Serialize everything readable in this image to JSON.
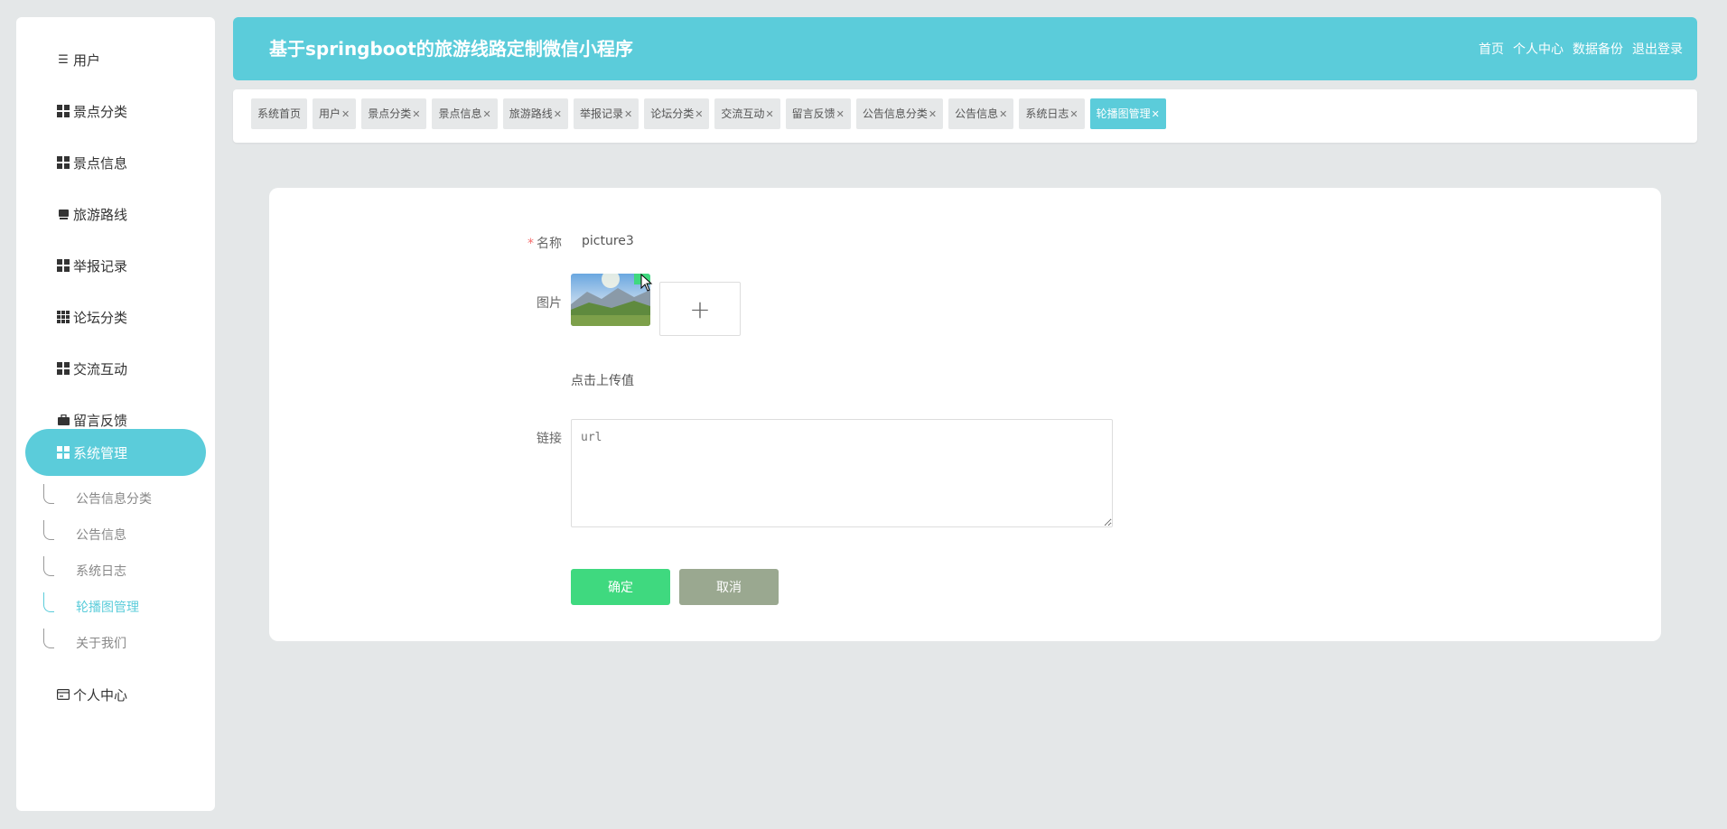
{
  "sidebar": {
    "items": [
      {
        "label": "用户",
        "icon": "list-icon"
      },
      {
        "label": "景点分类",
        "icon": "grid-icon"
      },
      {
        "label": "景点信息",
        "icon": "grid-icon"
      },
      {
        "label": "旅游路线",
        "icon": "store-icon"
      },
      {
        "label": "举报记录",
        "icon": "grid-icon"
      },
      {
        "label": "论坛分类",
        "icon": "grid9-icon"
      },
      {
        "label": "交流互动",
        "icon": "grid-icon"
      },
      {
        "label": "留言反馈",
        "icon": "briefcase-icon"
      },
      {
        "label": "系统管理",
        "icon": "grid-icon"
      },
      {
        "label": "个人中心",
        "icon": "card-icon"
      }
    ],
    "subitems": [
      "公告信息分类",
      "公告信息",
      "系统日志",
      "轮播图管理",
      "关于我们"
    ]
  },
  "header": {
    "title": "基于springboot的旅游线路定制微信小程序",
    "links": [
      "首页",
      "个人中心",
      "数据备份",
      "退出登录"
    ]
  },
  "tabs": [
    "系统首页",
    "用户",
    "景点分类",
    "景点信息",
    "旅游路线",
    "举报记录",
    "论坛分类",
    "交流互动",
    "留言反馈",
    "公告信息分类",
    "公告信息",
    "系统日志",
    "轮播图管理"
  ],
  "form": {
    "name_label": "名称",
    "required_mark": "*",
    "name_value": "picture3",
    "image_label": "图片",
    "upload_plus": "+",
    "upload_hint": "点击上传值",
    "link_label": "链接",
    "link_placeholder": "url",
    "ok_label": "确定",
    "cancel_label": "取消"
  },
  "colors": {
    "accent": "#5bccda",
    "confirm": "#3fd97f",
    "cancel": "#9aa890",
    "background": "#e4e7e8"
  }
}
